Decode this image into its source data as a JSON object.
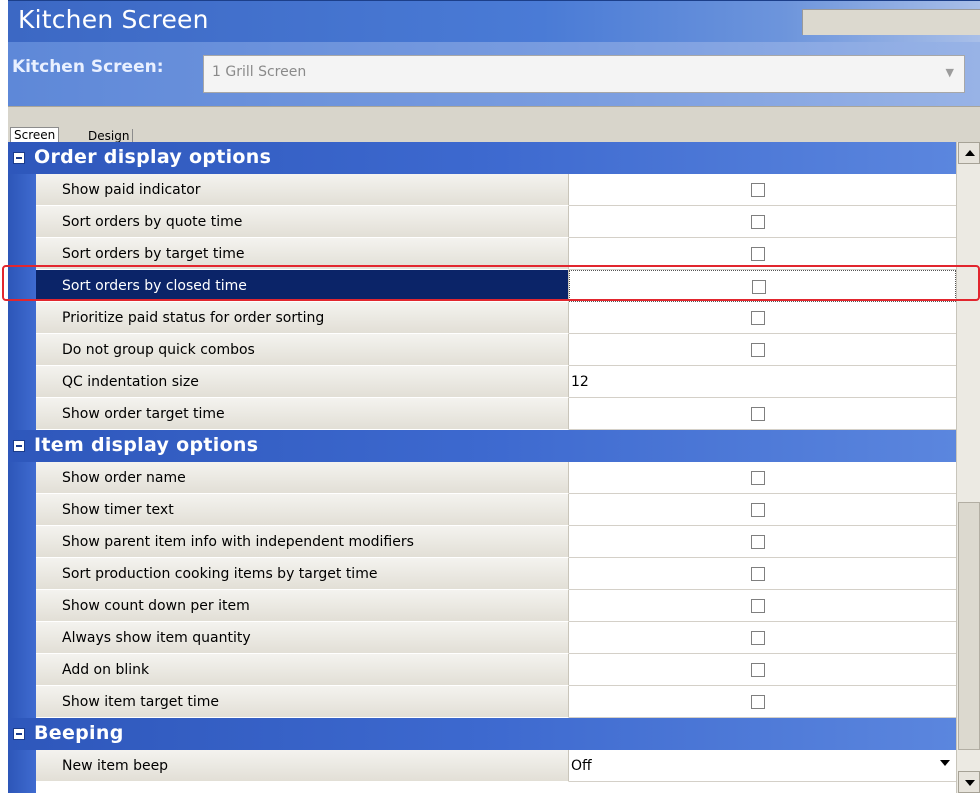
{
  "window": {
    "title": "Kitchen Screen"
  },
  "selector": {
    "label": "Kitchen Screen:",
    "value": "1 Grill Screen"
  },
  "tabs": [
    {
      "label": "Screen",
      "active": true
    },
    {
      "label": "Design",
      "active": false
    }
  ],
  "sections": [
    {
      "title": "Order display options",
      "rows": [
        {
          "label": "Show paid indicator",
          "type": "checkbox",
          "checked": false
        },
        {
          "label": "Sort orders by quote time",
          "type": "checkbox",
          "checked": false
        },
        {
          "label": "Sort orders by target time",
          "type": "checkbox",
          "checked": false
        },
        {
          "label": "Sort orders by closed time",
          "type": "checkbox",
          "checked": false,
          "selected": true
        },
        {
          "label": "Prioritize paid status for order sorting",
          "type": "checkbox",
          "checked": false
        },
        {
          "label": "Do not group quick combos",
          "type": "checkbox",
          "checked": false
        },
        {
          "label": "QC indentation size",
          "type": "text",
          "value": "12"
        },
        {
          "label": "Show order target time",
          "type": "checkbox",
          "checked": false
        }
      ]
    },
    {
      "title": "Item display options",
      "rows": [
        {
          "label": "Show order name",
          "type": "checkbox",
          "checked": false
        },
        {
          "label": "Show timer text",
          "type": "checkbox",
          "checked": false
        },
        {
          "label": "Show parent item info with independent modifiers",
          "type": "checkbox",
          "checked": false
        },
        {
          "label": "Sort production cooking items by target time",
          "type": "checkbox",
          "checked": false
        },
        {
          "label": "Show count down per item",
          "type": "checkbox",
          "checked": false
        },
        {
          "label": "Always show item quantity",
          "type": "checkbox",
          "checked": false
        },
        {
          "label": "Add on blink",
          "type": "checkbox",
          "checked": false
        },
        {
          "label": "Show item target time",
          "type": "checkbox",
          "checked": false
        }
      ]
    },
    {
      "title": "Beeping",
      "rows": [
        {
          "label": "New item beep",
          "type": "dropdown",
          "value": "Off"
        }
      ]
    }
  ],
  "colors": {
    "title_bar": "#3c68c4",
    "section_header": "#2e57bb",
    "selected_row": "#0b2468",
    "highlight_outline": "#e2262e"
  },
  "icons": {
    "collapse": "minus-box-icon",
    "dropdown": "chevron-down-icon",
    "scroll_up": "arrow-up-icon",
    "scroll_down": "arrow-down-icon"
  }
}
